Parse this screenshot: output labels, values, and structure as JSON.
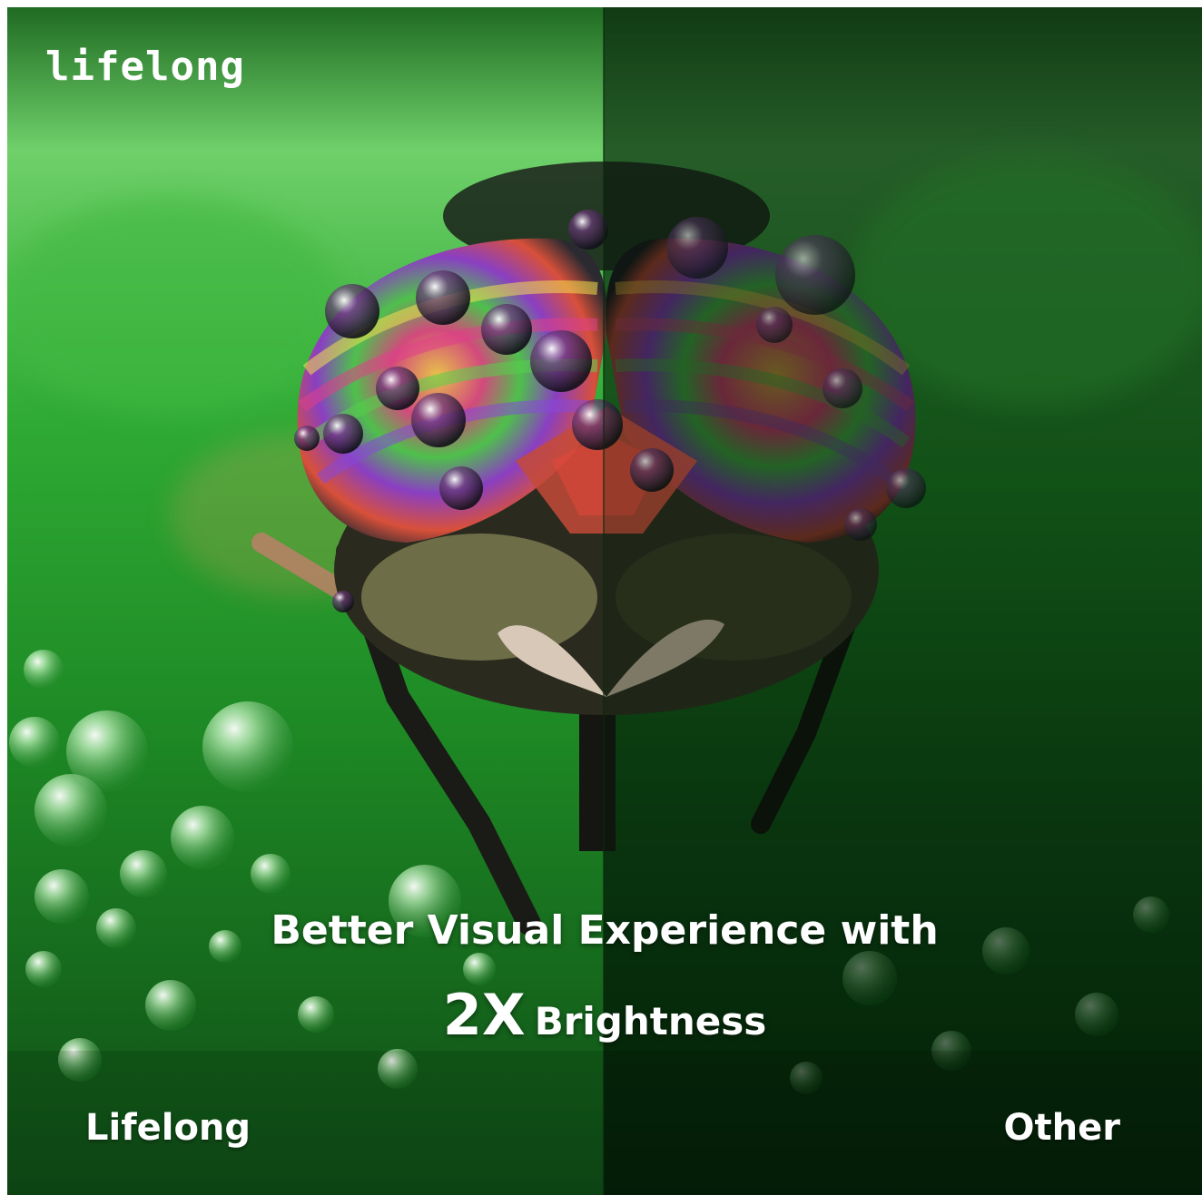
{
  "brand": {
    "logo_text": "lifelong"
  },
  "headline": {
    "line1": "Better Visual Experience with",
    "emphasis": "2X",
    "line2": "Brightness"
  },
  "comparison": {
    "left_label": "Lifelong",
    "right_label": "Other"
  },
  "colors": {
    "leaf_green": "#2e9a35",
    "dark_green": "#0d3a14",
    "text": "#ffffff"
  },
  "icons": [
    "fly-eye-closeup",
    "water-droplet"
  ]
}
